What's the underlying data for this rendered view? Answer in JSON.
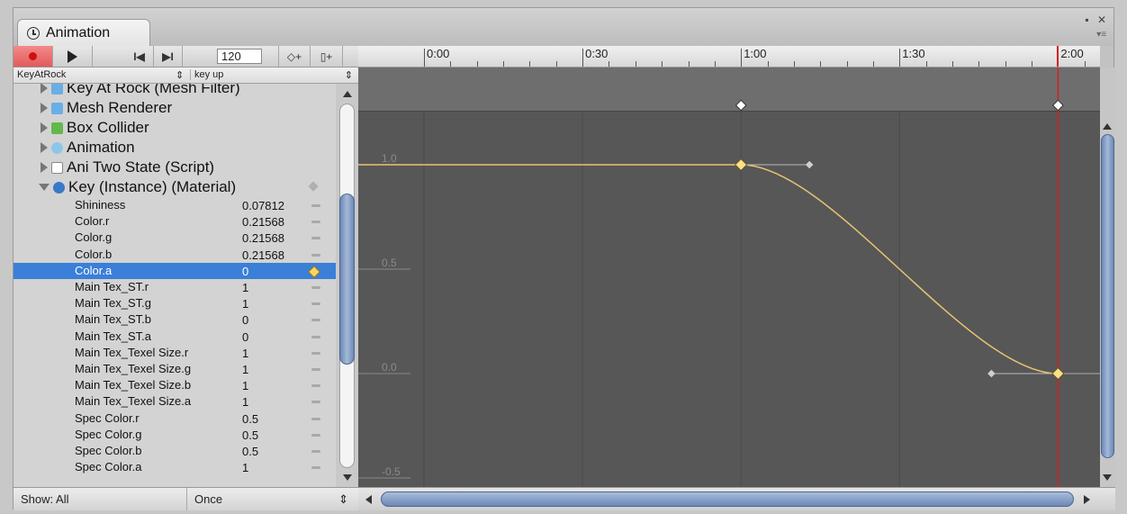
{
  "window": {
    "tab_title": "Animation",
    "tab_icon": "clock-icon",
    "controls": [
      "▪",
      "✕"
    ],
    "menu_icon": "▾≡"
  },
  "toolbar": {
    "record_icon": "record-icon",
    "play_icon": "play-icon",
    "prev_key_label": "I◀",
    "next_key_label": "▶I",
    "frame_value": "120",
    "add_key_label": "◇+",
    "add_event_label": "▯+"
  },
  "timeline": {
    "ruler_labels": [
      "0:00",
      "0:30",
      "1:00",
      "1:30",
      "2:00"
    ],
    "current_time": "2:00",
    "cursor_color": "#d42020"
  },
  "clip": {
    "clip_name": "KeyAtRock",
    "event_name": "key up",
    "select_arrow": "⇕",
    "dropdown_arrow": "⇕"
  },
  "tree": {
    "components": [
      {
        "label": "Key At Rock (Mesh Filter)",
        "icon": "mesh-filter-icon",
        "color": "#6aaee8"
      },
      {
        "label": "Mesh Renderer",
        "icon": "mesh-renderer-icon",
        "color": "#6aaee8"
      },
      {
        "label": "Box Collider",
        "icon": "box-collider-icon",
        "color": "#63b84a"
      },
      {
        "label": "Animation",
        "icon": "animation-component-icon",
        "color": "#8ec6ea"
      },
      {
        "label": "Ani Two State (Script)",
        "icon": "script-icon",
        "color": "#ffffff"
      },
      {
        "label": "Key (Instance) (Material)",
        "icon": "material-icon",
        "color": "#3a78c8"
      }
    ],
    "properties": [
      {
        "name": "Shininess",
        "value": "0.07812"
      },
      {
        "name": "Color.r",
        "value": "0.21568"
      },
      {
        "name": "Color.g",
        "value": "0.21568"
      },
      {
        "name": "Color.b",
        "value": "0.21568"
      },
      {
        "name": "Color.a",
        "value": "0",
        "selected": true
      },
      {
        "name": "Main Tex_ST.r",
        "value": "1"
      },
      {
        "name": "Main Tex_ST.g",
        "value": "1"
      },
      {
        "name": "Main Tex_ST.b",
        "value": "0"
      },
      {
        "name": "Main Tex_ST.a",
        "value": "0"
      },
      {
        "name": "Main Tex_Texel Size.r",
        "value": "1"
      },
      {
        "name": "Main Tex_Texel Size.g",
        "value": "1"
      },
      {
        "name": "Main Tex_Texel Size.b",
        "value": "1"
      },
      {
        "name": "Main Tex_Texel Size.a",
        "value": "1"
      },
      {
        "name": "Spec Color.r",
        "value": "0.5"
      },
      {
        "name": "Spec Color.g",
        "value": "0.5"
      },
      {
        "name": "Spec Color.b",
        "value": "0.5"
      },
      {
        "name": "Spec Color.a",
        "value": "1"
      }
    ]
  },
  "bottom": {
    "show_filter": "Show: All",
    "wrap_mode": "Once",
    "wrap_arrow": "⇕"
  },
  "curve": {
    "y_labels": [
      "1.0",
      "0.5",
      "0.0",
      "-0.5"
    ],
    "curve_color": "#e8c470",
    "keyframes": [
      {
        "time": "1:00",
        "value": 1.0
      },
      {
        "time": "2:00",
        "value": 0.0
      }
    ]
  }
}
